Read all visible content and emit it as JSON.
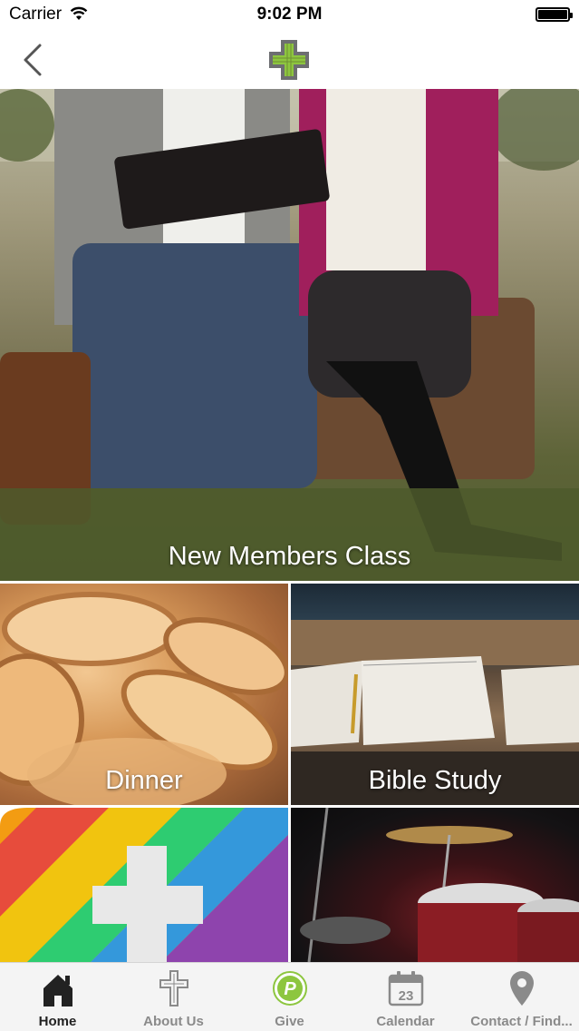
{
  "status_bar": {
    "carrier": "Carrier",
    "time": "9:02 PM"
  },
  "nav": {
    "back_icon": "chevron-left-icon",
    "logo": "cross-logo-icon"
  },
  "tiles": [
    {
      "label": "New Members Class"
    },
    {
      "label": "Dinner"
    },
    {
      "label": "Bible Study"
    },
    {
      "label": ""
    },
    {
      "label": ""
    }
  ],
  "tab_bar": {
    "tabs": [
      {
        "label": "Home",
        "icon": "home-icon",
        "active": true
      },
      {
        "label": "About Us",
        "icon": "cross-icon",
        "active": false
      },
      {
        "label": "Give",
        "icon": "give-p-icon",
        "active": false
      },
      {
        "label": "Calendar",
        "icon": "calendar-icon",
        "active": false,
        "badge": "23"
      },
      {
        "label": "Contact / Find...",
        "icon": "map-pin-icon",
        "active": false
      }
    ]
  },
  "colors": {
    "logo_green": "#8dc63f",
    "logo_gray": "#6d6e71",
    "tab_active": "#222222",
    "tab_inactive": "#8a8a8a"
  }
}
